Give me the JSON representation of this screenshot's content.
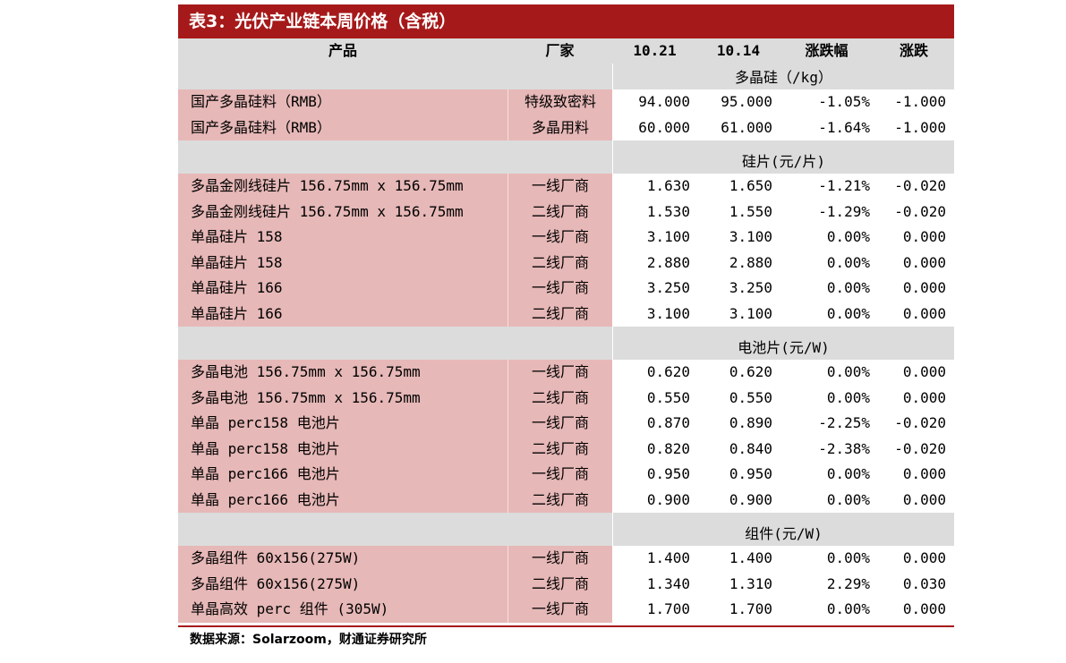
{
  "title": "表3：光伏产业链本周价格（含税）",
  "columns": {
    "product": "产品",
    "factory": "厂家",
    "date1": "10.21",
    "date2": "10.14",
    "pct": "涨跌幅",
    "chg": "涨跌"
  },
  "sections": [
    {
      "label": "多晶硅（/kg）",
      "rows": [
        {
          "product": "国产多晶硅料（RMB）",
          "factory": "特级致密料",
          "v1": "94.000",
          "v2": "95.000",
          "pct": "-1.05%",
          "chg": "-1.000"
        },
        {
          "product": "国产多晶硅料（RMB）",
          "factory": "多晶用料",
          "v1": "60.000",
          "v2": "61.000",
          "pct": "-1.64%",
          "chg": "-1.000"
        }
      ]
    },
    {
      "label": "硅片(元/片)",
      "rows": [
        {
          "product": "多晶金刚线硅片 156.75mm x 156.75mm",
          "factory": "一线厂商",
          "v1": "1.630",
          "v2": "1.650",
          "pct": "-1.21%",
          "chg": "-0.020"
        },
        {
          "product": "多晶金刚线硅片 156.75mm x 156.75mm",
          "factory": "二线厂商",
          "v1": "1.530",
          "v2": "1.550",
          "pct": "-1.29%",
          "chg": "-0.020"
        },
        {
          "product": "单晶硅片 158",
          "factory": "一线厂商",
          "v1": "3.100",
          "v2": "3.100",
          "pct": "0.00%",
          "chg": "0.000"
        },
        {
          "product": "单晶硅片 158",
          "factory": "二线厂商",
          "v1": "2.880",
          "v2": "2.880",
          "pct": "0.00%",
          "chg": "0.000"
        },
        {
          "product": "单晶硅片 166",
          "factory": "一线厂商",
          "v1": "3.250",
          "v2": "3.250",
          "pct": "0.00%",
          "chg": "0.000"
        },
        {
          "product": "单晶硅片 166",
          "factory": "二线厂商",
          "v1": "3.100",
          "v2": "3.100",
          "pct": "0.00%",
          "chg": "0.000"
        }
      ]
    },
    {
      "label": "电池片(元/W)",
      "rows": [
        {
          "product": "多晶电池 156.75mm x 156.75mm",
          "factory": "一线厂商",
          "v1": "0.620",
          "v2": "0.620",
          "pct": "0.00%",
          "chg": "0.000"
        },
        {
          "product": "多晶电池 156.75mm x 156.75mm",
          "factory": "二线厂商",
          "v1": "0.550",
          "v2": "0.550",
          "pct": "0.00%",
          "chg": "0.000"
        },
        {
          "product": "单晶 perc158 电池片",
          "factory": "一线厂商",
          "v1": "0.870",
          "v2": "0.890",
          "pct": "-2.25%",
          "chg": "-0.020"
        },
        {
          "product": "单晶 perc158 电池片",
          "factory": "二线厂商",
          "v1": "0.820",
          "v2": "0.840",
          "pct": "-2.38%",
          "chg": "-0.020"
        },
        {
          "product": "单晶 perc166 电池片",
          "factory": "一线厂商",
          "v1": "0.950",
          "v2": "0.950",
          "pct": "0.00%",
          "chg": "0.000"
        },
        {
          "product": "单晶 perc166 电池片",
          "factory": "二线厂商",
          "v1": "0.900",
          "v2": "0.900",
          "pct": "0.00%",
          "chg": "0.000"
        }
      ]
    },
    {
      "label": "组件(元/W)",
      "rows": [
        {
          "product": "多晶组件 60x156(275W)",
          "factory": "一线厂商",
          "v1": "1.400",
          "v2": "1.400",
          "pct": "0.00%",
          "chg": "0.000"
        },
        {
          "product": "多晶组件 60x156(275W)",
          "factory": "二线厂商",
          "v1": "1.340",
          "v2": "1.310",
          "pct": "2.29%",
          "chg": "0.030"
        },
        {
          "product": "单晶高效 perc 组件 (305W)",
          "factory": "一线厂商",
          "v1": "1.700",
          "v2": "1.700",
          "pct": "0.00%",
          "chg": "0.000"
        }
      ]
    }
  ],
  "source": "数据来源：Solarzoom，财通证券研究所",
  "colors": {
    "title_bg": "#a6191a",
    "header_bg": "#dcdcdc",
    "product_bg": "#e6b8b7"
  }
}
